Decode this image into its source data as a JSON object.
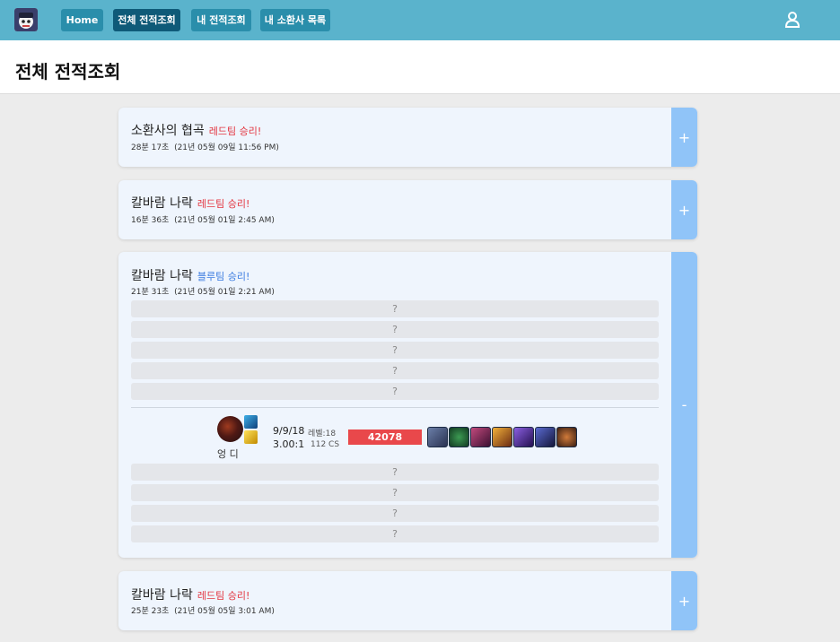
{
  "nav": {
    "items": [
      "Home",
      "전체 전적조회",
      "내 전적조회",
      "내 소환사 목록"
    ],
    "active_index": 1
  },
  "header": {
    "title": "전체 전적조회"
  },
  "games": [
    {
      "mode": "소환사의 협곡",
      "result": "레드팀 승리!",
      "result_team": "red",
      "duration": "28분 17초",
      "date": "(21년 05월 09일 11:56 PM)",
      "toggle": "+"
    },
    {
      "mode": "칼바람 나락",
      "result": "레드팀 승리!",
      "result_team": "red",
      "duration": "16분 36초",
      "date": "(21년 05월 01일 2:45 AM)",
      "toggle": "+"
    },
    {
      "mode": "칼바람 나락",
      "result": "블루팀 승리!",
      "result_team": "blue",
      "duration": "21분 31초",
      "date": "(21년 05월 01일 2:21 AM)",
      "toggle": "-",
      "hidden_rows_top": [
        "?",
        "?",
        "?",
        "?",
        "?"
      ],
      "player": {
        "name": "엉 디",
        "kda": "9/9/18",
        "ratio": "3.00:1",
        "level": "레벨:18",
        "cs": "112 CS",
        "damage": "42078",
        "item_icons": [
          "item-1-icon",
          "item-2-icon",
          "item-3-icon",
          "item-4-icon",
          "item-5-icon",
          "item-6-icon",
          "item-7-icon"
        ]
      },
      "hidden_rows_bottom": [
        "?",
        "?",
        "?",
        "?"
      ]
    },
    {
      "mode": "칼바람 나락",
      "result": "레드팀 승리!",
      "result_team": "red",
      "duration": "25분 23초",
      "date": "(21년 05월 05일 3:01 AM)",
      "toggle": "+"
    }
  ],
  "colors": {
    "topbar": "#5ab3cc",
    "nav_button": "#2a8eab",
    "nav_active": "#0f5a78",
    "card": "#eff5fd",
    "toggle": "#90c4f8",
    "red_win": "#e3343e",
    "blue_win": "#3b7ce0",
    "damage_bar": "#e9484b"
  }
}
